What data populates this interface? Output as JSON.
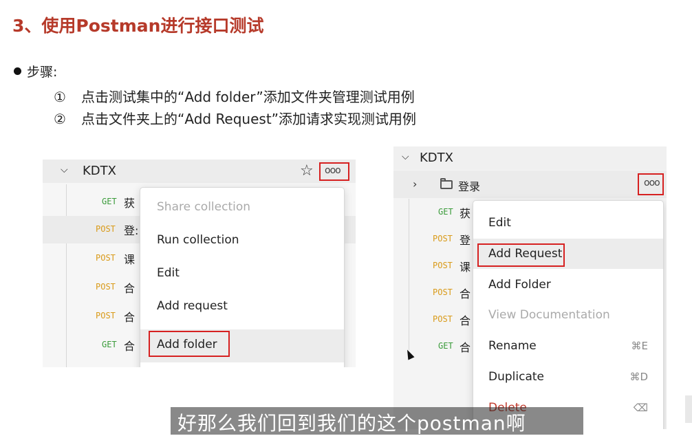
{
  "slide": {
    "title": "3、使用Postman进行接口测试",
    "steps_label": "步骤:",
    "steps": [
      {
        "num": "①",
        "text": "点击测试集中的“Add folder”添加文件夹管理测试用例"
      },
      {
        "num": "②",
        "text": "点击文件夹上的“Add Request”添加请求实现测试用例"
      }
    ]
  },
  "left_panel": {
    "collection": "KDTX",
    "chevron": "chevron-down-icon",
    "more_button": "ooo",
    "requests": [
      {
        "method": "GET",
        "name": "获"
      },
      {
        "method": "POST",
        "name": "登:"
      },
      {
        "method": "POST",
        "name": "课"
      },
      {
        "method": "POST",
        "name": "合"
      },
      {
        "method": "POST",
        "name": "合"
      },
      {
        "method": "GET",
        "name": "合"
      }
    ],
    "menu": [
      {
        "label": "Share collection",
        "disabled": true
      },
      {
        "label": "Run collection"
      },
      {
        "label": "Edit"
      },
      {
        "label": "Add request"
      },
      {
        "label": "Add folder",
        "highlighted": true
      }
    ]
  },
  "right_panel": {
    "collection": "KDTX",
    "folder": "登录",
    "more_button": "ooo",
    "requests": [
      {
        "method": "GET",
        "name": "获"
      },
      {
        "method": "POST",
        "name": "登"
      },
      {
        "method": "POST",
        "name": "课"
      },
      {
        "method": "POST",
        "name": "合"
      },
      {
        "method": "POST",
        "name": "合"
      },
      {
        "method": "GET",
        "name": "合"
      }
    ],
    "menu": [
      {
        "label": "Edit"
      },
      {
        "label": "Add Request",
        "highlighted": true
      },
      {
        "label": "Add Folder"
      },
      {
        "label": "View Documentation",
        "disabled": true
      },
      {
        "label": "Rename",
        "shortcut": "⌘E"
      },
      {
        "label": "Duplicate",
        "shortcut": "⌘D"
      },
      {
        "label": "Delete",
        "shortcut": "⌫"
      }
    ]
  },
  "subtitle": "好那么我们回到我们的这个postman啊",
  "colors": {
    "title": "#b63a2a",
    "highlight_border": "#d62020",
    "get": "#3a9b3a",
    "post": "#d99a18",
    "delete": "#c0392b"
  }
}
